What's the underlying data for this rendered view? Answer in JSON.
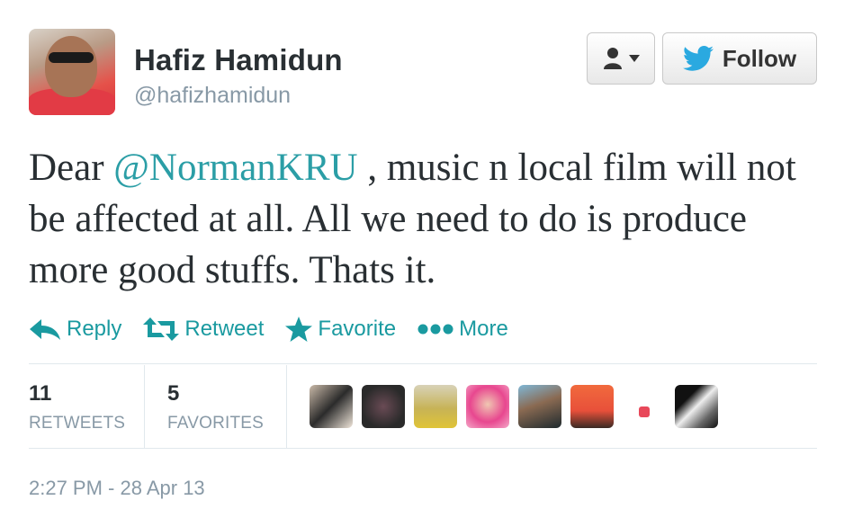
{
  "profile": {
    "name": "Hafiz Hamidun",
    "handle": "@hafizhamidun"
  },
  "buttons": {
    "follow_label": "Follow"
  },
  "tweet": {
    "prefix": "Dear ",
    "mention": "@NormanKRU",
    "suffix": " , music n local film will not be affected at all. All we need to do is produce more good stuffs. Thats it."
  },
  "actions": {
    "reply": "Reply",
    "retweet": "Retweet",
    "favorite": "Favorite",
    "more": "More"
  },
  "stats": {
    "retweets_count": "11",
    "retweets_label": "RETWEETS",
    "favorites_count": "5",
    "favorites_label": "FAVORITES"
  },
  "timestamp": "2:27 PM - 28 Apr 13",
  "colors": {
    "accent": "#2b9ea6",
    "muted": "#8899a6",
    "twitter_blue": "#2aa9e0"
  }
}
